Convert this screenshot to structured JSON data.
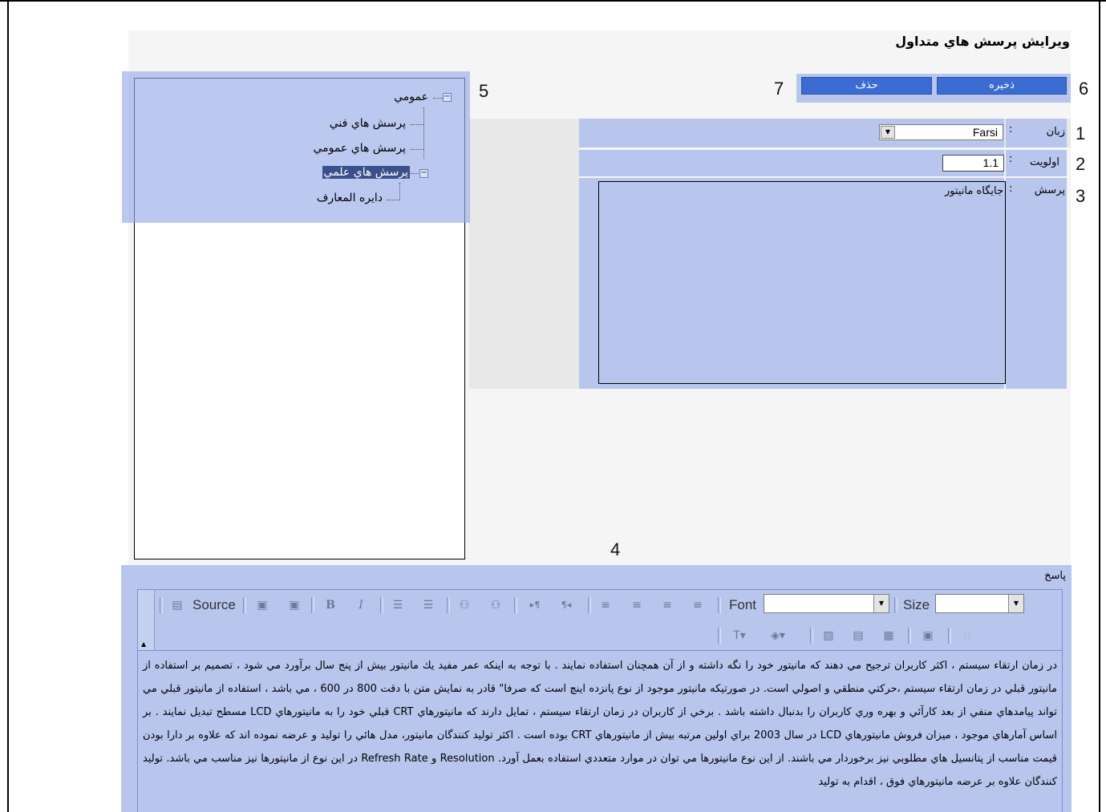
{
  "page": {
    "title": "ويرايش پرسش هاي متداول"
  },
  "callouts": [
    "1",
    "2",
    "3",
    "4",
    "5",
    "6",
    "7"
  ],
  "actions": {
    "save_label": "ذخيره",
    "delete_label": "حذف"
  },
  "form": {
    "language_label": "زبان",
    "language_value": "Farsi",
    "priority_label": "اولويت",
    "priority_value": "1.1",
    "question_label": "پرسش",
    "question_value": "جايگاه مانيتور",
    "colon": ":"
  },
  "tree": {
    "root": "عمومي",
    "children": [
      "پرسش هاي فني",
      "پرسش هاي عمومي",
      "پرسش هاي علمي"
    ],
    "grandchild": "دايره المعارف",
    "selected": "پرسش هاي علمي"
  },
  "answer": {
    "label": "پاسخ",
    "toolbar": {
      "source_label": "Source",
      "font_label": "Font",
      "size_label": "Size"
    },
    "body_text": "در زمان ارتقاء سيستم ، اكثر كاربران ترجيح مي دهند كه مانيتور خود را نگه داشته و از آن همچنان استفاده نمايند . با توجه به اينكه عمر مفيد يك مانيتور بيش از پنج سال برآورد مي شود ، تصميم بر استفاده از مانيتور قبلي در زمان ارتقاء سيستم ،حركتي منطقي و اصولي است. در صورتيكه مانيتور موجود از نوع پانزده اينچ است كه صرفا\" قادر به نمايش متن با دقت 800 در 600 ، مي باشد ، استفاده از مانيتور قبلي مي تواند پيامدهاي منفي از بعد كارآئي و بهره وري كاربران را بدنبال داشته باشد . برخي از كاربران در زمان ارتقاء سيستم ، تمايل دارند كه مانيتورهاي CRT قبلي خود را به مانيتورهاي LCD مسطح تبديل نمايند . بر اساس آمارهاي موجود ، ميزان فروش مانيتورهاي LCD در سال 2003 براي اولين مرتبه بيش از مانيتورهاي CRT بوده است . اكثر توليد كنندگان مانيتور، مدل هائي را توليد و عرضه نموده اند كه علاوه بر دارا بودن قيمت مناسب از پتانسيل هاي مطلوبي نيز برخوردار مي باشند. از اين نوع مانيتورها مي توان در موارد متعددي استفاده بعمل آورد. Resolution و Refresh Rate در اين نوع از مانيتورها نيز مناسب مي باشد. توليد كنندگان علاوه بر عرضه مانيتورهاي فوق ، اقدام به توليد"
  },
  "colors": {
    "band": "#b8c6ee",
    "button": "#3b6cd2",
    "selected": "#3a4f8c"
  }
}
